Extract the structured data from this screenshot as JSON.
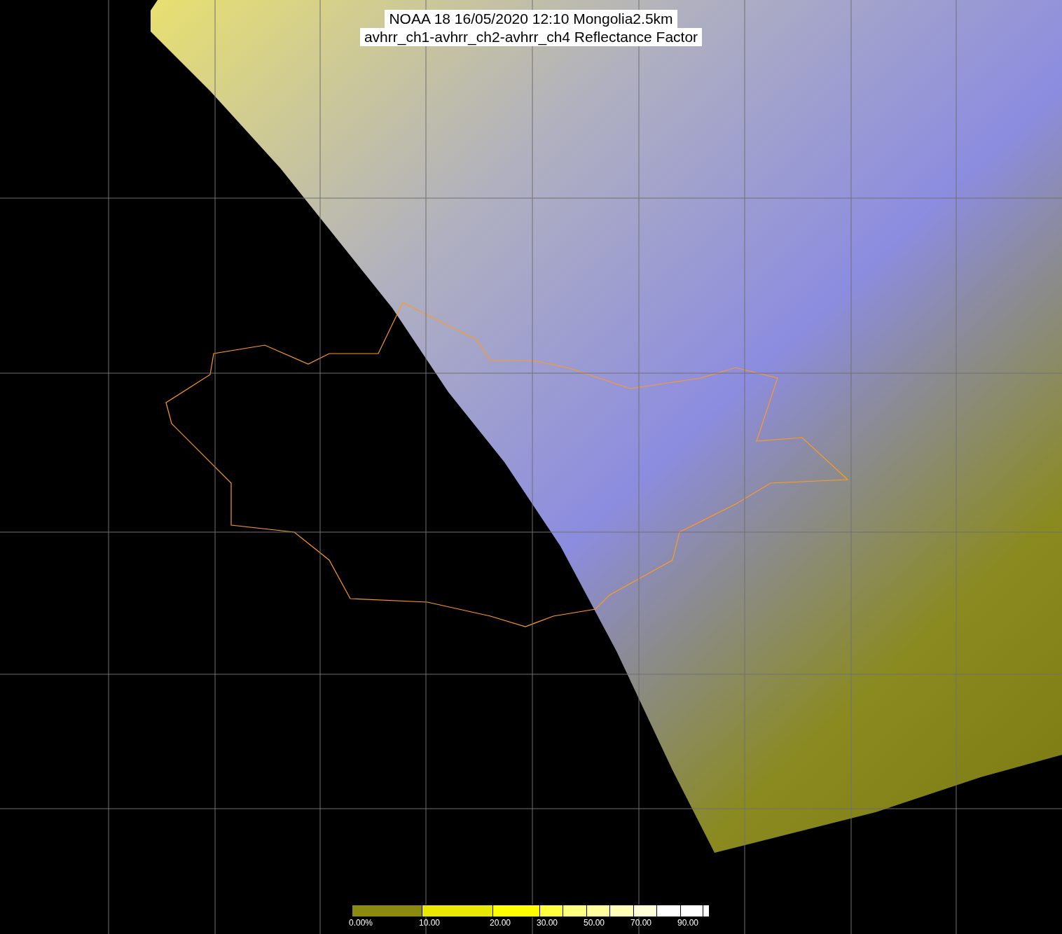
{
  "title": {
    "lines": [
      "NOAA 18 16/05/2020 12:10 Mongolia2.5km",
      "avhrr_ch1-avhrr_ch2-avhrr_ch4 Reflectance Factor"
    ]
  },
  "legend": {
    "segments": [
      {
        "label": "0.00%",
        "color": "#8a8a10"
      },
      {
        "label": "10.00",
        "color": "#e8e800"
      },
      {
        "label": "20.00",
        "color": "#ffff00"
      },
      {
        "label": "30.00",
        "color": "#ffff40"
      },
      {
        "color": "#ffff80"
      },
      {
        "label": "50.00",
        "color": "#ffffa0"
      },
      {
        "color": "#ffffb8"
      },
      {
        "label": "70.00",
        "color": "#ffffd8"
      },
      {
        "color": "#ffffff"
      },
      {
        "label": "90.00",
        "color": "#ffffff"
      },
      {
        "color": "#ffffff"
      }
    ]
  }
}
